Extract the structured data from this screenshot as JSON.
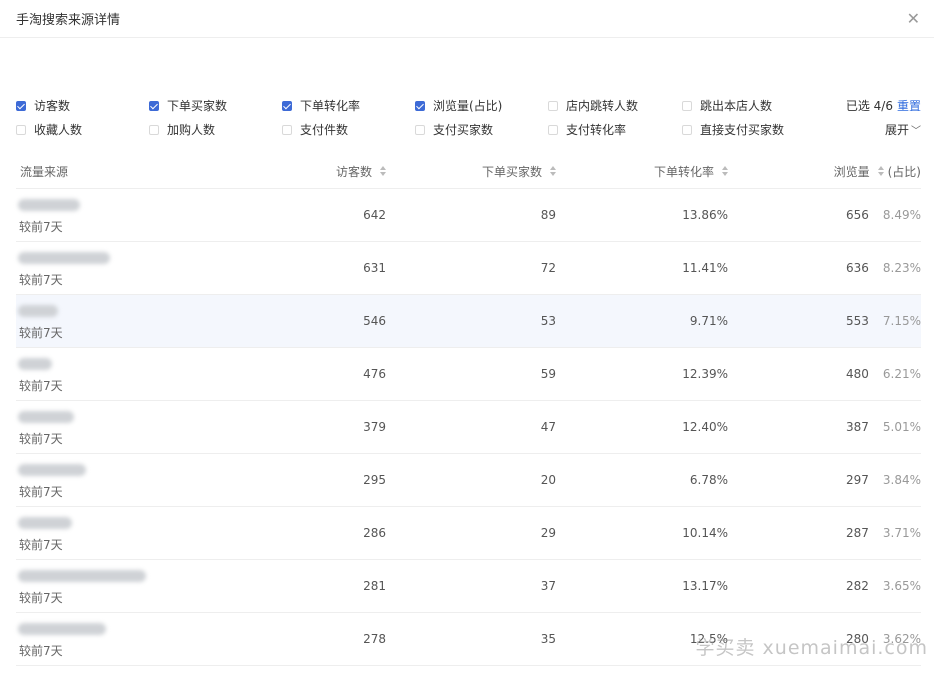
{
  "dialog": {
    "title": "手淘搜索来源详情",
    "close_icon": "close-icon"
  },
  "filters": {
    "row1": [
      {
        "label": "访客数",
        "checked": true
      },
      {
        "label": "下单买家数",
        "checked": true
      },
      {
        "label": "下单转化率",
        "checked": true
      },
      {
        "label": "浏览量(占比)",
        "checked": true
      },
      {
        "label": "店内跳转人数",
        "checked": false
      },
      {
        "label": "跳出本店人数",
        "checked": false
      }
    ],
    "row2": [
      {
        "label": "收藏人数",
        "checked": false
      },
      {
        "label": "加购人数",
        "checked": false
      },
      {
        "label": "支付件数",
        "checked": false
      },
      {
        "label": "支付买家数",
        "checked": false
      },
      {
        "label": "支付转化率",
        "checked": false
      },
      {
        "label": "直接支付买家数",
        "checked": false
      }
    ],
    "selected_text": "已选 4/6",
    "reset_label": "重置",
    "expand_label": "展开",
    "accent": "#3d6ad6"
  },
  "table": {
    "headers": {
      "source": "流量来源",
      "visitors": "访客数",
      "buyers": "下单买家数",
      "conversion": "下单转化率",
      "pageviews": "浏览量",
      "share": "(占比)"
    },
    "rows": [
      {
        "compare": "较前7天",
        "visitors": "642",
        "buyers": "89",
        "conversion": "13.86%",
        "pageviews": "656",
        "share": "8.49%",
        "highlight": false
      },
      {
        "compare": "较前7天",
        "visitors": "631",
        "buyers": "72",
        "conversion": "11.41%",
        "pageviews": "636",
        "share": "8.23%",
        "highlight": false
      },
      {
        "compare": "较前7天",
        "visitors": "546",
        "buyers": "53",
        "conversion": "9.71%",
        "pageviews": "553",
        "share": "7.15%",
        "highlight": true
      },
      {
        "compare": "较前7天",
        "visitors": "476",
        "buyers": "59",
        "conversion": "12.39%",
        "pageviews": "480",
        "share": "6.21%",
        "highlight": false
      },
      {
        "compare": "较前7天",
        "visitors": "379",
        "buyers": "47",
        "conversion": "12.40%",
        "pageviews": "387",
        "share": "5.01%",
        "highlight": false
      },
      {
        "compare": "较前7天",
        "visitors": "295",
        "buyers": "20",
        "conversion": "6.78%",
        "pageviews": "297",
        "share": "3.84%",
        "highlight": false
      },
      {
        "compare": "较前7天",
        "visitors": "286",
        "buyers": "29",
        "conversion": "10.14%",
        "pageviews": "287",
        "share": "3.71%",
        "highlight": false
      },
      {
        "compare": "较前7天",
        "visitors": "281",
        "buyers": "37",
        "conversion": "13.17%",
        "pageviews": "282",
        "share": "3.65%",
        "highlight": false
      },
      {
        "compare": "较前7天",
        "visitors": "278",
        "buyers": "35",
        "conversion": "12.5%",
        "pageviews": "280",
        "share": "3.62%",
        "highlight": false
      }
    ]
  },
  "watermark": "学买卖 xuemaimai.com"
}
